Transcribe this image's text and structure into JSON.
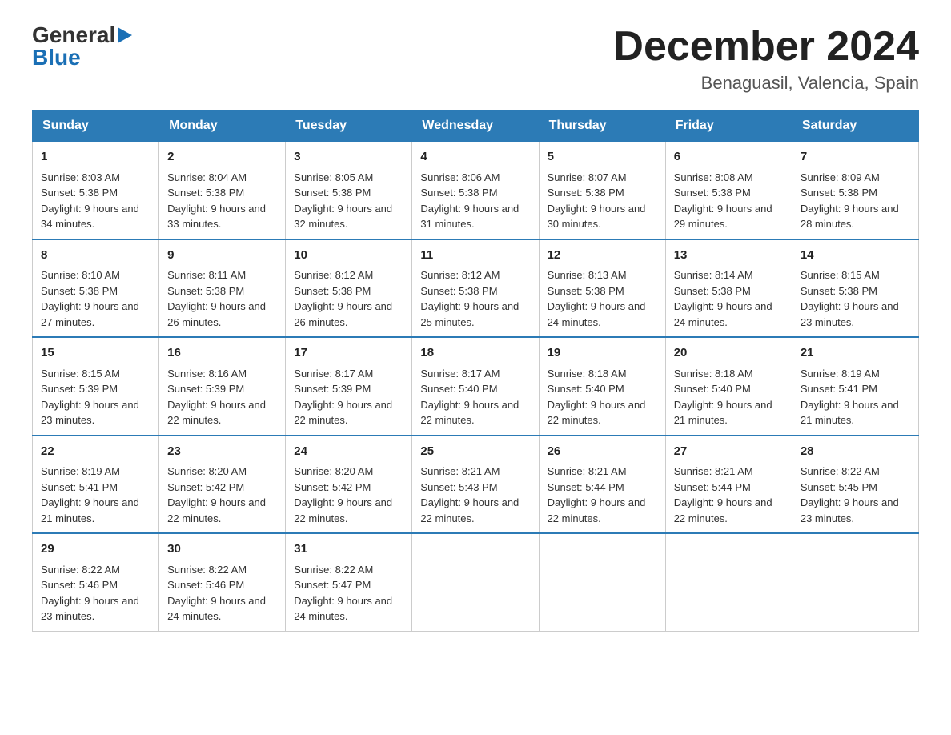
{
  "header": {
    "logo_general": "General",
    "logo_blue": "Blue",
    "month_title": "December 2024",
    "subtitle": "Benaguasil, Valencia, Spain"
  },
  "days": [
    "Sunday",
    "Monday",
    "Tuesday",
    "Wednesday",
    "Thursday",
    "Friday",
    "Saturday"
  ],
  "weeks": [
    [
      {
        "num": "1",
        "sunrise": "8:03 AM",
        "sunset": "5:38 PM",
        "daylight": "9 hours and 34 minutes."
      },
      {
        "num": "2",
        "sunrise": "8:04 AM",
        "sunset": "5:38 PM",
        "daylight": "9 hours and 33 minutes."
      },
      {
        "num": "3",
        "sunrise": "8:05 AM",
        "sunset": "5:38 PM",
        "daylight": "9 hours and 32 minutes."
      },
      {
        "num": "4",
        "sunrise": "8:06 AM",
        "sunset": "5:38 PM",
        "daylight": "9 hours and 31 minutes."
      },
      {
        "num": "5",
        "sunrise": "8:07 AM",
        "sunset": "5:38 PM",
        "daylight": "9 hours and 30 minutes."
      },
      {
        "num": "6",
        "sunrise": "8:08 AM",
        "sunset": "5:38 PM",
        "daylight": "9 hours and 29 minutes."
      },
      {
        "num": "7",
        "sunrise": "8:09 AM",
        "sunset": "5:38 PM",
        "daylight": "9 hours and 28 minutes."
      }
    ],
    [
      {
        "num": "8",
        "sunrise": "8:10 AM",
        "sunset": "5:38 PM",
        "daylight": "9 hours and 27 minutes."
      },
      {
        "num": "9",
        "sunrise": "8:11 AM",
        "sunset": "5:38 PM",
        "daylight": "9 hours and 26 minutes."
      },
      {
        "num": "10",
        "sunrise": "8:12 AM",
        "sunset": "5:38 PM",
        "daylight": "9 hours and 26 minutes."
      },
      {
        "num": "11",
        "sunrise": "8:12 AM",
        "sunset": "5:38 PM",
        "daylight": "9 hours and 25 minutes."
      },
      {
        "num": "12",
        "sunrise": "8:13 AM",
        "sunset": "5:38 PM",
        "daylight": "9 hours and 24 minutes."
      },
      {
        "num": "13",
        "sunrise": "8:14 AM",
        "sunset": "5:38 PM",
        "daylight": "9 hours and 24 minutes."
      },
      {
        "num": "14",
        "sunrise": "8:15 AM",
        "sunset": "5:38 PM",
        "daylight": "9 hours and 23 minutes."
      }
    ],
    [
      {
        "num": "15",
        "sunrise": "8:15 AM",
        "sunset": "5:39 PM",
        "daylight": "9 hours and 23 minutes."
      },
      {
        "num": "16",
        "sunrise": "8:16 AM",
        "sunset": "5:39 PM",
        "daylight": "9 hours and 22 minutes."
      },
      {
        "num": "17",
        "sunrise": "8:17 AM",
        "sunset": "5:39 PM",
        "daylight": "9 hours and 22 minutes."
      },
      {
        "num": "18",
        "sunrise": "8:17 AM",
        "sunset": "5:40 PM",
        "daylight": "9 hours and 22 minutes."
      },
      {
        "num": "19",
        "sunrise": "8:18 AM",
        "sunset": "5:40 PM",
        "daylight": "9 hours and 22 minutes."
      },
      {
        "num": "20",
        "sunrise": "8:18 AM",
        "sunset": "5:40 PM",
        "daylight": "9 hours and 21 minutes."
      },
      {
        "num": "21",
        "sunrise": "8:19 AM",
        "sunset": "5:41 PM",
        "daylight": "9 hours and 21 minutes."
      }
    ],
    [
      {
        "num": "22",
        "sunrise": "8:19 AM",
        "sunset": "5:41 PM",
        "daylight": "9 hours and 21 minutes."
      },
      {
        "num": "23",
        "sunrise": "8:20 AM",
        "sunset": "5:42 PM",
        "daylight": "9 hours and 22 minutes."
      },
      {
        "num": "24",
        "sunrise": "8:20 AM",
        "sunset": "5:42 PM",
        "daylight": "9 hours and 22 minutes."
      },
      {
        "num": "25",
        "sunrise": "8:21 AM",
        "sunset": "5:43 PM",
        "daylight": "9 hours and 22 minutes."
      },
      {
        "num": "26",
        "sunrise": "8:21 AM",
        "sunset": "5:44 PM",
        "daylight": "9 hours and 22 minutes."
      },
      {
        "num": "27",
        "sunrise": "8:21 AM",
        "sunset": "5:44 PM",
        "daylight": "9 hours and 22 minutes."
      },
      {
        "num": "28",
        "sunrise": "8:22 AM",
        "sunset": "5:45 PM",
        "daylight": "9 hours and 23 minutes."
      }
    ],
    [
      {
        "num": "29",
        "sunrise": "8:22 AM",
        "sunset": "5:46 PM",
        "daylight": "9 hours and 23 minutes."
      },
      {
        "num": "30",
        "sunrise": "8:22 AM",
        "sunset": "5:46 PM",
        "daylight": "9 hours and 24 minutes."
      },
      {
        "num": "31",
        "sunrise": "8:22 AM",
        "sunset": "5:47 PM",
        "daylight": "9 hours and 24 minutes."
      },
      null,
      null,
      null,
      null
    ]
  ]
}
